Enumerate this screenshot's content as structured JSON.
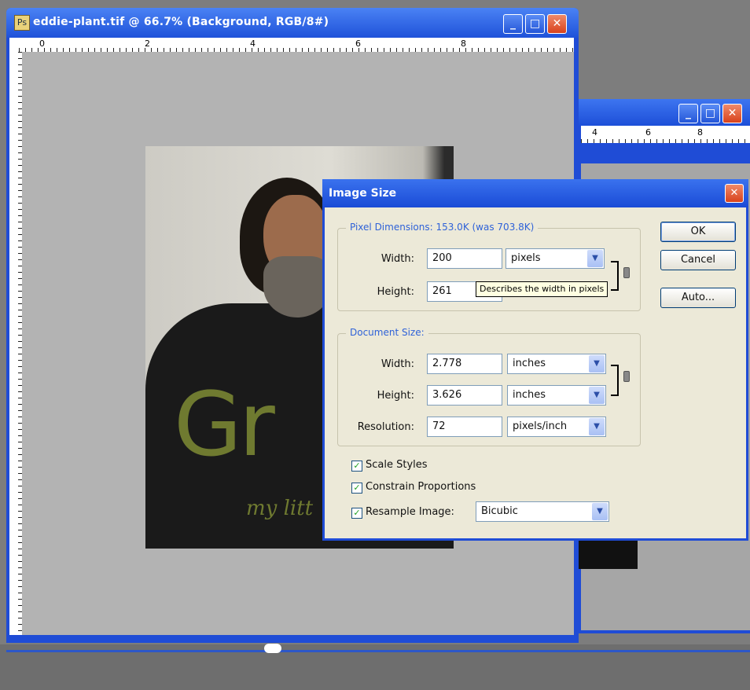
{
  "main_window": {
    "title": "eddie-plant.tif @ 66.7% (Background, RGB/8#)",
    "ruler_top_labels": [
      "0",
      "2",
      "4",
      "6",
      "8"
    ],
    "buttons": {
      "minimize": "_",
      "maximize": "□",
      "close": "✕"
    }
  },
  "back_window": {
    "ruler_top_labels": [
      "4",
      "6",
      "8"
    ],
    "buttons": {
      "minimize": "_",
      "maximize": "□",
      "close": "✕"
    }
  },
  "photo": {
    "text_large": "Gr",
    "text_small": "my litt"
  },
  "dialog": {
    "title": "Image Size",
    "close": "✕",
    "pixel_dimensions": {
      "legend": "Pixel Dimensions:  153.0K (was 703.8K)",
      "width_label": "Width:",
      "width_value": "200",
      "width_unit": "pixels",
      "height_label": "Height:",
      "height_value": "261",
      "tooltip": "Describes the width in pixels"
    },
    "document_size": {
      "legend": "Document Size:",
      "width_label": "Width:",
      "width_value": "2.778",
      "width_unit": "inches",
      "height_label": "Height:",
      "height_value": "3.626",
      "height_unit": "inches",
      "resolution_label": "Resolution:",
      "resolution_value": "72",
      "resolution_unit": "pixels/inch"
    },
    "buttons": {
      "ok": "OK",
      "cancel": "Cancel",
      "auto": "Auto..."
    },
    "checkboxes": {
      "scale_styles": "Scale Styles",
      "constrain": "Constrain Proportions",
      "resample": "Resample Image:",
      "check_mark": "✓"
    },
    "resample_method": "Bicubic",
    "dropdown_arrow": "▼"
  }
}
